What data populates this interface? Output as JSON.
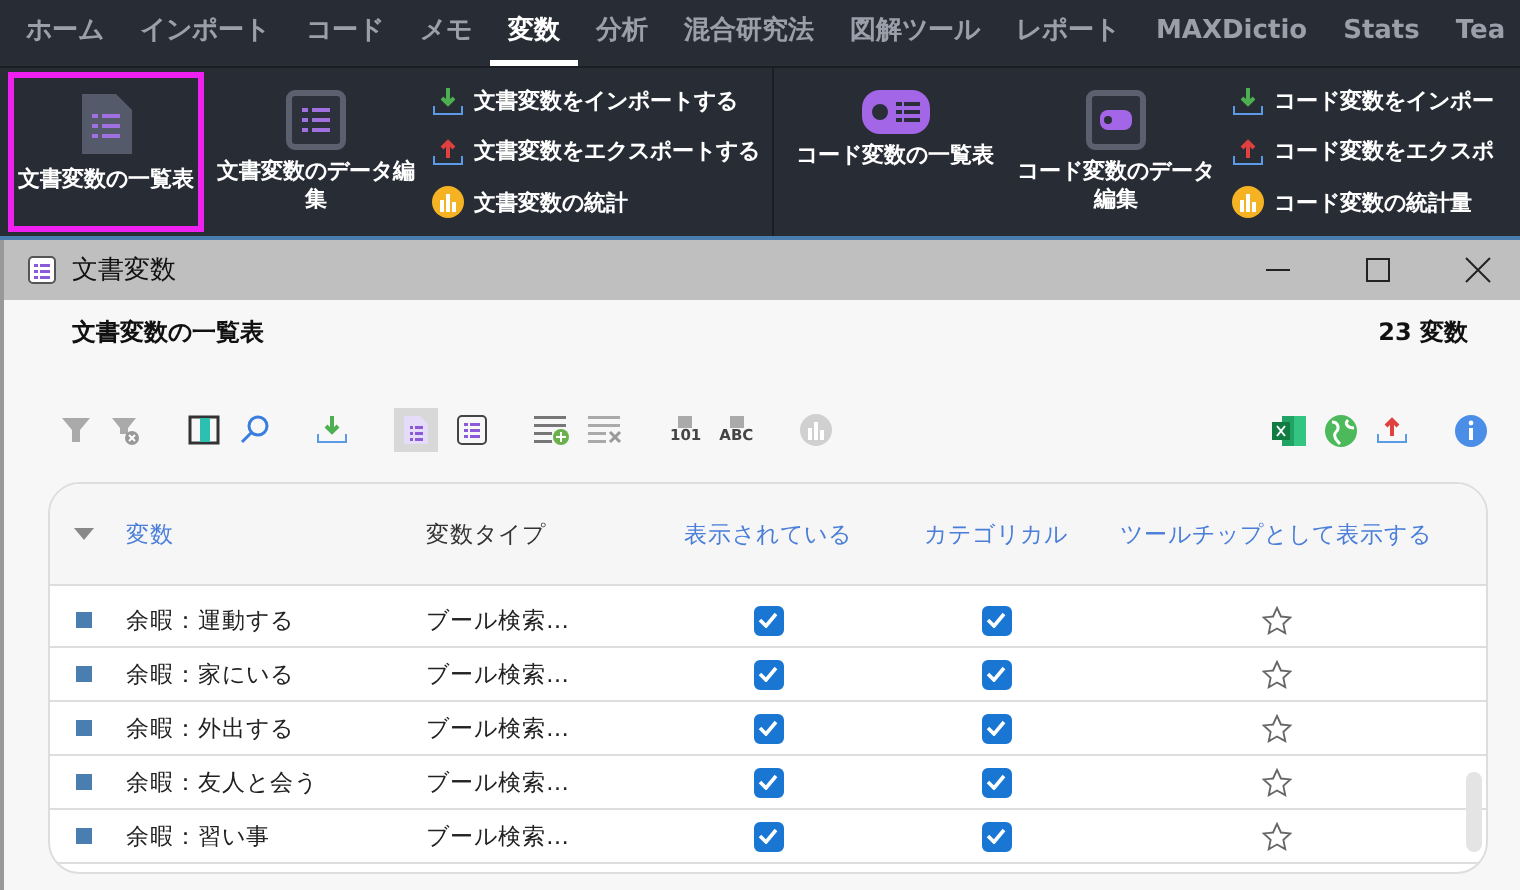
{
  "menu_tabs": [
    {
      "label": "ホーム",
      "selected": false
    },
    {
      "label": "インポート",
      "selected": false
    },
    {
      "label": "コード",
      "selected": false
    },
    {
      "label": "メモ",
      "selected": false
    },
    {
      "label": "変数",
      "selected": true
    },
    {
      "label": "分析",
      "selected": false
    },
    {
      "label": "混合研究法",
      "selected": false
    },
    {
      "label": "図解ツール",
      "selected": false
    },
    {
      "label": "レポート",
      "selected": false
    },
    {
      "label": "MAXDictio",
      "selected": false
    },
    {
      "label": "Stats",
      "selected": false
    },
    {
      "label": "Tea",
      "selected": false
    }
  ],
  "ribbon_groups": [
    {
      "kind": "document",
      "large": [
        {
          "label": "文書変数の一覧表",
          "selected": true
        },
        {
          "label": "文書変数のデータ編集",
          "selected": false
        }
      ],
      "small": [
        "文書変数をインポートする",
        "文書変数をエクスポートする",
        "文書変数の統計"
      ]
    },
    {
      "kind": "code",
      "large": [
        {
          "label": "コード変数の一覧表",
          "selected": false
        },
        {
          "label": "コード変数のデータ編集",
          "selected": false
        }
      ],
      "small": [
        "コード変数をインポー",
        "コード変数をエクスポ",
        "コード変数の統計量"
      ]
    }
  ],
  "window": {
    "title": "文書変数",
    "heading": "文書変数の一覧表",
    "count": "23 変数"
  },
  "toolbar": {
    "convert_labels": [
      "101",
      "ABC"
    ]
  },
  "table": {
    "columns": [
      "変数",
      "変数タイプ",
      "表示されている",
      "カテゴリカル",
      "ツールチップとして表示する"
    ],
    "rows": [
      {
        "name": "余暇：運動する",
        "type": "ブール検索…",
        "visible": true,
        "categorical": true,
        "tooltip": false
      },
      {
        "name": "余暇：家にいる",
        "type": "ブール検索…",
        "visible": true,
        "categorical": true,
        "tooltip": false
      },
      {
        "name": "余暇：外出する",
        "type": "ブール検索…",
        "visible": true,
        "categorical": true,
        "tooltip": false
      },
      {
        "name": "余暇：友人と会う",
        "type": "ブール検索…",
        "visible": true,
        "categorical": true,
        "tooltip": false
      },
      {
        "name": "余暇：習い事",
        "type": "ブール検索…",
        "visible": true,
        "categorical": true,
        "tooltip": false
      }
    ]
  }
}
